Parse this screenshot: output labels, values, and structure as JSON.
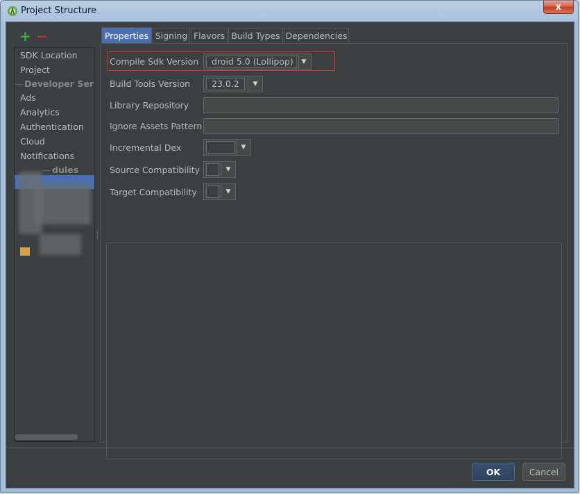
{
  "window": {
    "title": "Project Structure",
    "close_label": "x"
  },
  "toolbar": {
    "add_label": "+",
    "remove_label": "−"
  },
  "sidebar": {
    "items": [
      {
        "label": "SDK Location",
        "type": "item"
      },
      {
        "label": "Project",
        "type": "item"
      },
      {
        "label": "Developer Servic",
        "type": "header"
      },
      {
        "label": "Ads",
        "type": "item"
      },
      {
        "label": "Analytics",
        "type": "item"
      },
      {
        "label": "Authentication",
        "type": "item"
      },
      {
        "label": "Cloud",
        "type": "item"
      },
      {
        "label": "Notifications",
        "type": "item"
      },
      {
        "label": "dules",
        "type": "header"
      }
    ]
  },
  "tabs": [
    {
      "label": "Properties",
      "active": true
    },
    {
      "label": "Signing",
      "active": false
    },
    {
      "label": "Flavors",
      "active": false
    },
    {
      "label": "Build Types",
      "active": false
    },
    {
      "label": "Dependencies",
      "active": false
    }
  ],
  "form": {
    "compile_sdk_label": "Compile Sdk Version",
    "compile_sdk_value": "droid 5.0 (Lollipop)",
    "build_tools_label": "Build Tools Version",
    "build_tools_value": "23.0.2",
    "library_repo_label": "Library Repository",
    "library_repo_value": "",
    "ignore_assets_label": "Ignore Assets Pattern",
    "ignore_assets_value": "",
    "incremental_dex_label": "Incremental Dex",
    "source_compat_label": "Source Compatibility",
    "target_compat_label": "Target Compatibility"
  },
  "buttons": {
    "ok_label": "OK",
    "cancel_label": "Cancel"
  },
  "colors": {
    "background": "#3c3f41",
    "selection": "#4b6eaf",
    "highlight_border": "#e0302a",
    "add_green": "#36b040",
    "remove_red": "#c7302c"
  }
}
